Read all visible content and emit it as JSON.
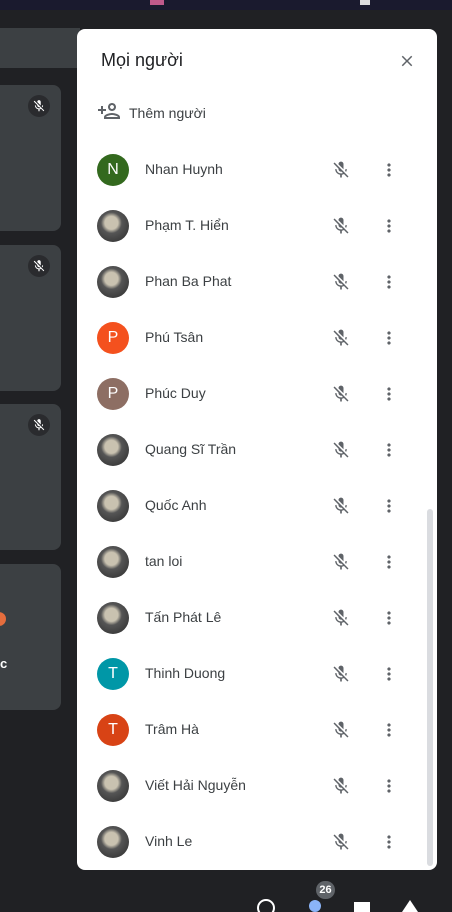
{
  "panel": {
    "title": "Mọi người",
    "add_people_label": "Thêm người"
  },
  "icons": {
    "close": "close-icon",
    "add_person": "person-add-icon",
    "mic_off": "mic-off-icon",
    "more": "more-vert-icon"
  },
  "participants": [
    {
      "name": "Nhan Huynh",
      "initial": "N",
      "color": "#33691e"
    },
    {
      "name": "Phạm T. Hiển",
      "initial": "",
      "color": ""
    },
    {
      "name": "Phan Ba Phat",
      "initial": "",
      "color": ""
    },
    {
      "name": "Phú Tsân",
      "initial": "P",
      "color": "#f4511e"
    },
    {
      "name": "Phúc Duy",
      "initial": "P",
      "color": "#8d6e63"
    },
    {
      "name": "Quang Sĩ Trần",
      "initial": "",
      "color": ""
    },
    {
      "name": "Quốc Anh",
      "initial": "",
      "color": ""
    },
    {
      "name": "tan loi",
      "initial": "",
      "color": ""
    },
    {
      "name": "Tấn Phát Lê",
      "initial": "",
      "color": ""
    },
    {
      "name": "Thinh Duong",
      "initial": "T",
      "color": "#0097a7"
    },
    {
      "name": "Trâm Hà",
      "initial": "T",
      "color": "#d84315"
    },
    {
      "name": "Viết Hải Nguyễn",
      "initial": "",
      "color": ""
    },
    {
      "name": "Vinh Le",
      "initial": "",
      "color": ""
    }
  ],
  "participant_count": "26",
  "left_tiles": {
    "partial_char": "c"
  }
}
